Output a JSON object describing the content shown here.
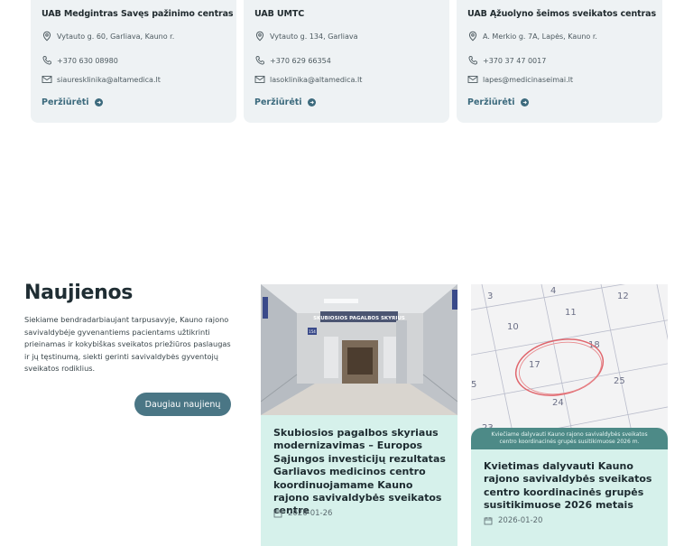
{
  "clinics": [
    {
      "name": "UAB Medgintras Savęs pažinimo centras",
      "address": "Vytauto g. 60, Garliava, Kauno r.",
      "phone": "+370 630 08980",
      "email": "siaureskIinika@altamedica.lt",
      "link_label": "Peržiūrėti"
    },
    {
      "name": "UAB UMTC",
      "address": "Vytauto g. 134, Garliava",
      "phone": "+370 629 66354",
      "email": "lasoklinika@altamedica.lt",
      "link_label": "Peržiūrėti"
    },
    {
      "name": "UAB Ąžuolyno šeimos sveikatos centras",
      "address": "A. Merkio g. 7A, Lapės, Kauno r.",
      "phone": "+370 37 47 0017",
      "email": "lapes@medicinaseimai.lt",
      "link_label": "Peržiūrėti"
    }
  ],
  "news": {
    "heading": "Naujienos",
    "description": "Siekiame bendradarbiaujant tarpusavyje, Kauno rajono savivaldybėje gyvenantiems pacientams užtikrinti prieinamas ir kokybiškas sveikatos priežiūros paslaugas ir jų tęstinumą, siekti gerinti savivaldybės gyventojų sveikatos rodiklius.",
    "more_button": "Daugiau naujienų",
    "items": [
      {
        "image_sign": "SKUBIOSIOS PAGALBOS SKYRIUS",
        "room_number": "154",
        "title": "Skubiosios pagalbos skyriaus modernizavimas – Europos Sąjungos investicijų rezultatas Garliavos medicinos centro koordinuojamame Kauno rajono savivaldybės sveikatos centre",
        "date": "2026-01-26"
      },
      {
        "image_caption": "Kviečiame dalyvauti Kauno rajono savivaldybės sveikatos centro koordinacinės grupės susitikimuose 2026 m.",
        "calendar_numbers": [
          "3",
          "4",
          "11",
          "12",
          "10",
          "18",
          "17",
          "24",
          "25",
          "23",
          "5"
        ],
        "title": "Kvietimas dalyvauti Kauno rajono savivaldybės sveikatos centro koordinacinės grupės susitikimuose 2026 metais",
        "date": "2026-01-20"
      }
    ]
  },
  "colors": {
    "card_bg": "#eef2f4",
    "accent": "#3c6a7d",
    "button_bg": "#4a7685",
    "news_card_bg": "#d6f1eb"
  }
}
